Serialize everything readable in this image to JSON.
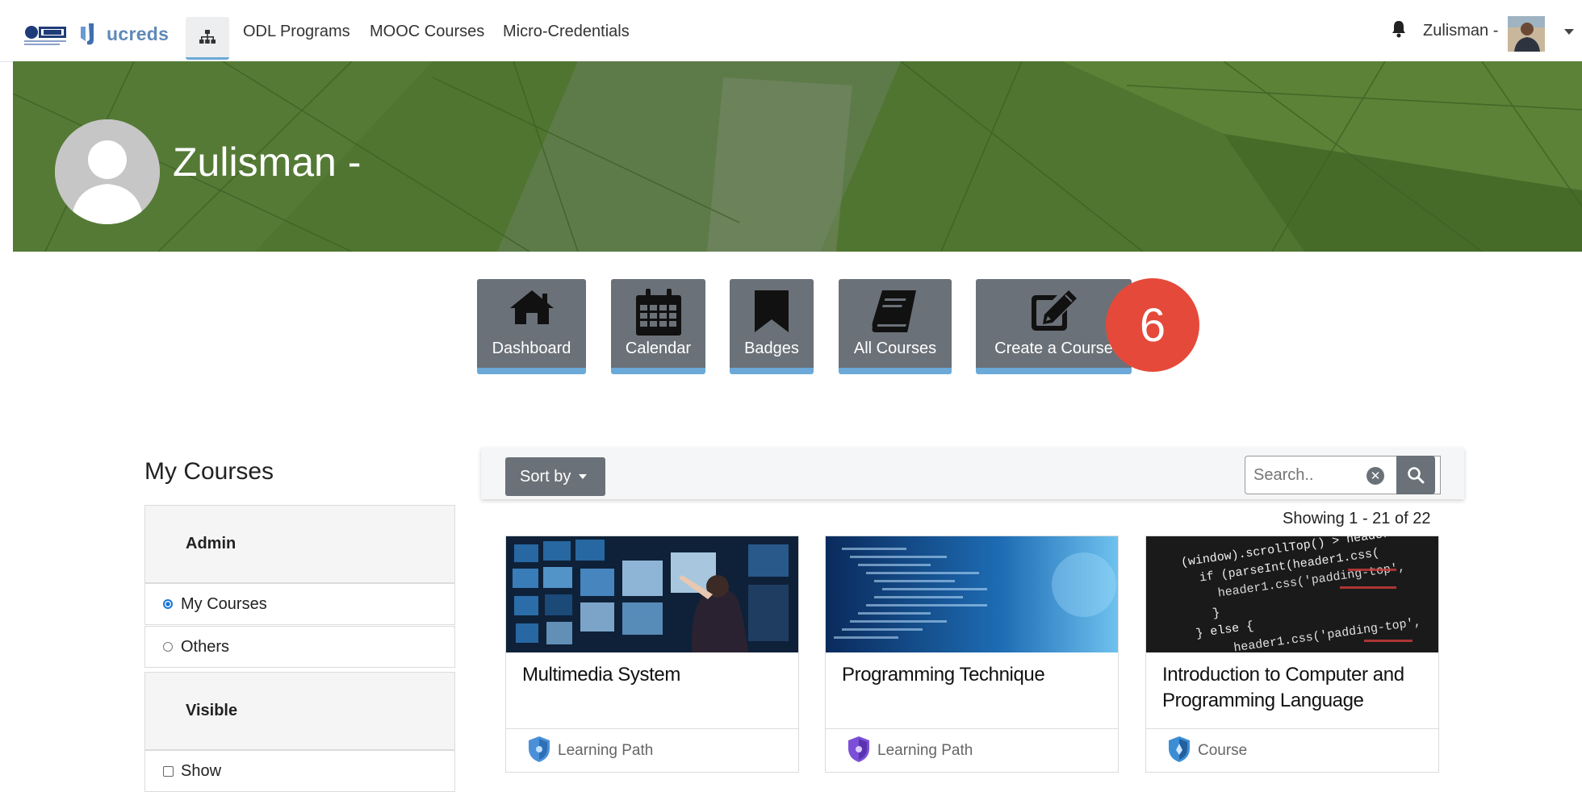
{
  "navbar": {
    "brand_text": "ucreds",
    "links": [
      "ODL Programs",
      "MOOC Courses",
      "Micro-Credentials"
    ],
    "user_name": "Zulisman -"
  },
  "profile": {
    "name": "Zulisman -"
  },
  "tiles": [
    {
      "label": "Dashboard",
      "icon": "home-icon"
    },
    {
      "label": "Calendar",
      "icon": "calendar-icon"
    },
    {
      "label": "Badges",
      "icon": "bookmark-icon"
    },
    {
      "label": "All Courses",
      "icon": "book-icon"
    },
    {
      "label": "Create a Course",
      "icon": "edit-icon"
    }
  ],
  "step_badge": "6",
  "sidebar": {
    "title": "My Courses",
    "admin_heading": "Admin",
    "admin_options": [
      "My Courses",
      "Others"
    ],
    "admin_selected": "My Courses",
    "visible_heading": "Visible",
    "visible_options": [
      "Show"
    ]
  },
  "toolbar": {
    "sort_label": "Sort by",
    "search_placeholder": "Search..",
    "showing": "Showing 1 - 21 of 22"
  },
  "courses": [
    {
      "title": "Multimedia System",
      "type": "Learning Path",
      "badge_color": "#4a90d9"
    },
    {
      "title": "Programming Technique",
      "type": "Learning Path",
      "badge_color": "#7b4fd8"
    },
    {
      "title": "Introduction to Computer and Programming Language",
      "type": "Course",
      "badge_color": "#3b8ed6"
    }
  ],
  "colors": {
    "banner": "#4f7530",
    "tile": "#6b7178",
    "tile_accent": "#6aa9d8",
    "step_badge": "#e5493a"
  }
}
